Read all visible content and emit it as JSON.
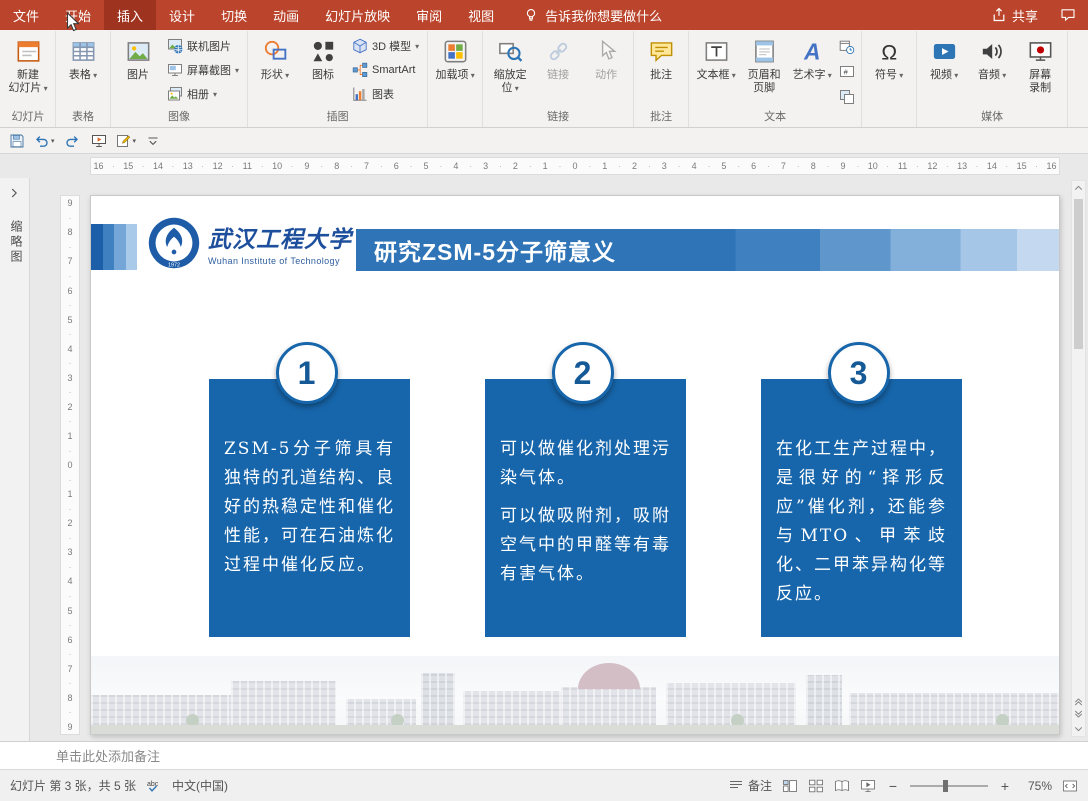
{
  "colors": {
    "ribbon_red": "#BB452C",
    "ribbon_red_active": "#9E331F",
    "box_blue": "#1766AB",
    "title_bar_blue": "#2E74B6",
    "logo_blue": "#1E4F9C"
  },
  "tabs": {
    "items": [
      {
        "id": "file",
        "label": "文件"
      },
      {
        "id": "home",
        "label": "开始"
      },
      {
        "id": "insert",
        "label": "插入",
        "active": true
      },
      {
        "id": "design",
        "label": "设计"
      },
      {
        "id": "transitions",
        "label": "切换"
      },
      {
        "id": "animations",
        "label": "动画"
      },
      {
        "id": "slide-show",
        "label": "幻灯片放映"
      },
      {
        "id": "review",
        "label": "审阅"
      },
      {
        "id": "view",
        "label": "视图"
      }
    ],
    "tell_me": "告诉我你想要做什么",
    "share": "共享"
  },
  "ribbon_groups": [
    {
      "id": "slides",
      "label": "幻灯片",
      "items": [
        {
          "type": "big",
          "label": "新建\n幻灯片",
          "icon": "new-slide",
          "dropdown": true
        }
      ]
    },
    {
      "id": "tables",
      "label": "表格",
      "items": [
        {
          "type": "big",
          "label": "表格",
          "icon": "table",
          "dropdown": true
        }
      ]
    },
    {
      "id": "images",
      "label": "图像",
      "items": [
        {
          "type": "big",
          "label": "图片",
          "icon": "picture"
        },
        {
          "type": "col",
          "buttons": [
            {
              "label": "联机图片",
              "icon": "online-pictures"
            },
            {
              "label": "屏幕截图",
              "icon": "screenshot",
              "dropdown": true
            },
            {
              "label": "相册",
              "icon": "photo-album",
              "dropdown": true
            }
          ]
        }
      ]
    },
    {
      "id": "illustrations",
      "label": "插图",
      "items": [
        {
          "type": "big",
          "label": "形状",
          "icon": "shapes",
          "dropdown": true
        },
        {
          "type": "big",
          "label": "图标",
          "icon": "icons"
        },
        {
          "type": "col",
          "buttons": [
            {
              "label": "3D 模型",
              "icon": "3d-model",
              "dropdown": true
            },
            {
              "label": "SmartArt",
              "icon": "smartart"
            },
            {
              "label": "图表",
              "icon": "chart"
            }
          ]
        }
      ]
    },
    {
      "id": "add-ins",
      "label": "",
      "items": [
        {
          "type": "big",
          "label": "加载项",
          "icon": "add-ins",
          "dropdown": true
        }
      ]
    },
    {
      "id": "links",
      "label": "链接",
      "items": [
        {
          "type": "big",
          "label": "缩放定\n位",
          "icon": "zoom-link",
          "dropdown": true
        },
        {
          "type": "big",
          "label": "链接",
          "icon": "link",
          "disabled": true
        },
        {
          "type": "big",
          "label": "动作",
          "icon": "action",
          "disabled": true
        }
      ]
    },
    {
      "id": "comments",
      "label": "批注",
      "items": [
        {
          "type": "big",
          "label": "批注",
          "icon": "comment"
        }
      ]
    },
    {
      "id": "text",
      "label": "文本",
      "items": [
        {
          "type": "big",
          "label": "文本框",
          "icon": "text-box",
          "dropdown": true
        },
        {
          "type": "big",
          "label": "页眉和\n页脚",
          "icon": "header-footer"
        },
        {
          "type": "big",
          "label": "艺术字",
          "icon": "wordart",
          "dropdown": true
        },
        {
          "type": "tiny-col",
          "icons": [
            "date-time",
            "slide-number",
            "object"
          ]
        }
      ]
    },
    {
      "id": "symbols",
      "label": "",
      "items": [
        {
          "type": "big",
          "label": "符号",
          "icon": "symbol-omega",
          "dropdown": true
        }
      ]
    },
    {
      "id": "media",
      "label": "媒体",
      "items": [
        {
          "type": "big",
          "label": "视频",
          "icon": "video",
          "dropdown": true
        },
        {
          "type": "big",
          "label": "音频",
          "icon": "audio",
          "dropdown": true
        },
        {
          "type": "big",
          "label": "屏幕\n录制",
          "icon": "screen-record"
        }
      ]
    }
  ],
  "qat": [
    {
      "name": "save",
      "icon": "save"
    },
    {
      "name": "undo",
      "icon": "undo",
      "dropdown": true
    },
    {
      "name": "redo",
      "icon": "redo"
    },
    {
      "name": "start-slideshow",
      "icon": "present"
    },
    {
      "name": "draw",
      "icon": "draw",
      "dropdown": true
    },
    {
      "name": "customize-qat",
      "icon": "qat-more"
    }
  ],
  "ruler": {
    "horizontal": [
      "16",
      "15",
      "14",
      "13",
      "12",
      "11",
      "10",
      "9",
      "8",
      "7",
      "6",
      "5",
      "4",
      "3",
      "2",
      "1",
      "0",
      "1",
      "2",
      "3",
      "4",
      "5",
      "6",
      "7",
      "8",
      "9",
      "10",
      "11",
      "12",
      "13",
      "14",
      "15",
      "16"
    ],
    "vertical": [
      "9",
      "8",
      "7",
      "6",
      "5",
      "4",
      "3",
      "2",
      "1",
      "0",
      "1",
      "2",
      "3",
      "4",
      "5",
      "6",
      "7",
      "8",
      "9"
    ]
  },
  "panel": {
    "thumbnails": "缩略图"
  },
  "slide": {
    "logo": {
      "zh": "武汉工程大学",
      "en": "Wuhan Institute of Technology"
    },
    "title": "研究ZSM-5分子筛意义",
    "columns": [
      {
        "number": "1",
        "paragraphs": [
          "ZSM-5分子筛具有独特的孔道结构、良好的热稳定性和催化性能，可在石油炼化过程中催化反应。"
        ]
      },
      {
        "number": "2",
        "paragraphs": [
          "可以做催化剂处理污染气体。",
          "可以做吸附剂，吸附空气中的甲醛等有毒有害气体。"
        ]
      },
      {
        "number": "3",
        "paragraphs": [
          "在化工生产过程中，是很好的“择形反应”催化剂，还能参与MTO、甲苯歧化、二甲苯异构化等反应。"
        ]
      }
    ]
  },
  "notes_placeholder": "单击此处添加备注",
  "statusbar": {
    "slide_info": "幻灯片 第 3 张，共 5 张",
    "language": "中文(中国)",
    "notes": "备注",
    "zoom": "75%",
    "zoom_out": "−",
    "zoom_in": "+"
  }
}
